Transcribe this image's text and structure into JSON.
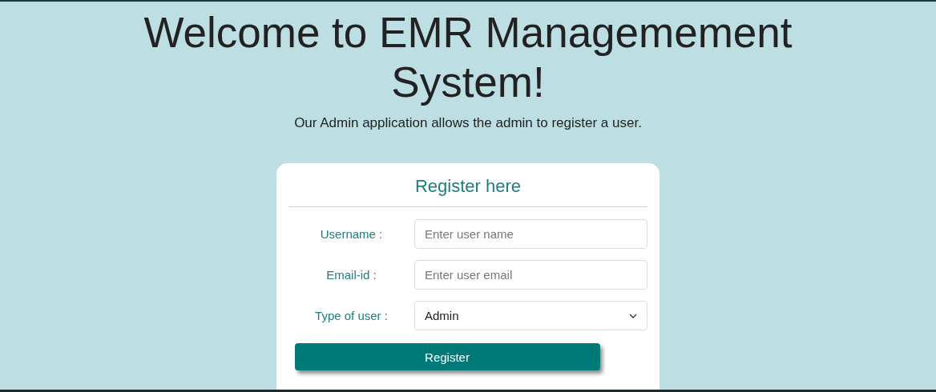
{
  "heading": "Welcome to EMR Managemement System!",
  "subtitle": "Our Admin application allows the admin to register a user.",
  "form": {
    "title": "Register here",
    "fields": [
      {
        "kind": "text",
        "label": "Username :",
        "placeholder": "Enter user name"
      },
      {
        "kind": "text",
        "label": "Email-id :",
        "placeholder": "Enter user email"
      },
      {
        "kind": "select",
        "label": "Type of user :",
        "value": "Admin"
      }
    ],
    "button": "Register"
  }
}
